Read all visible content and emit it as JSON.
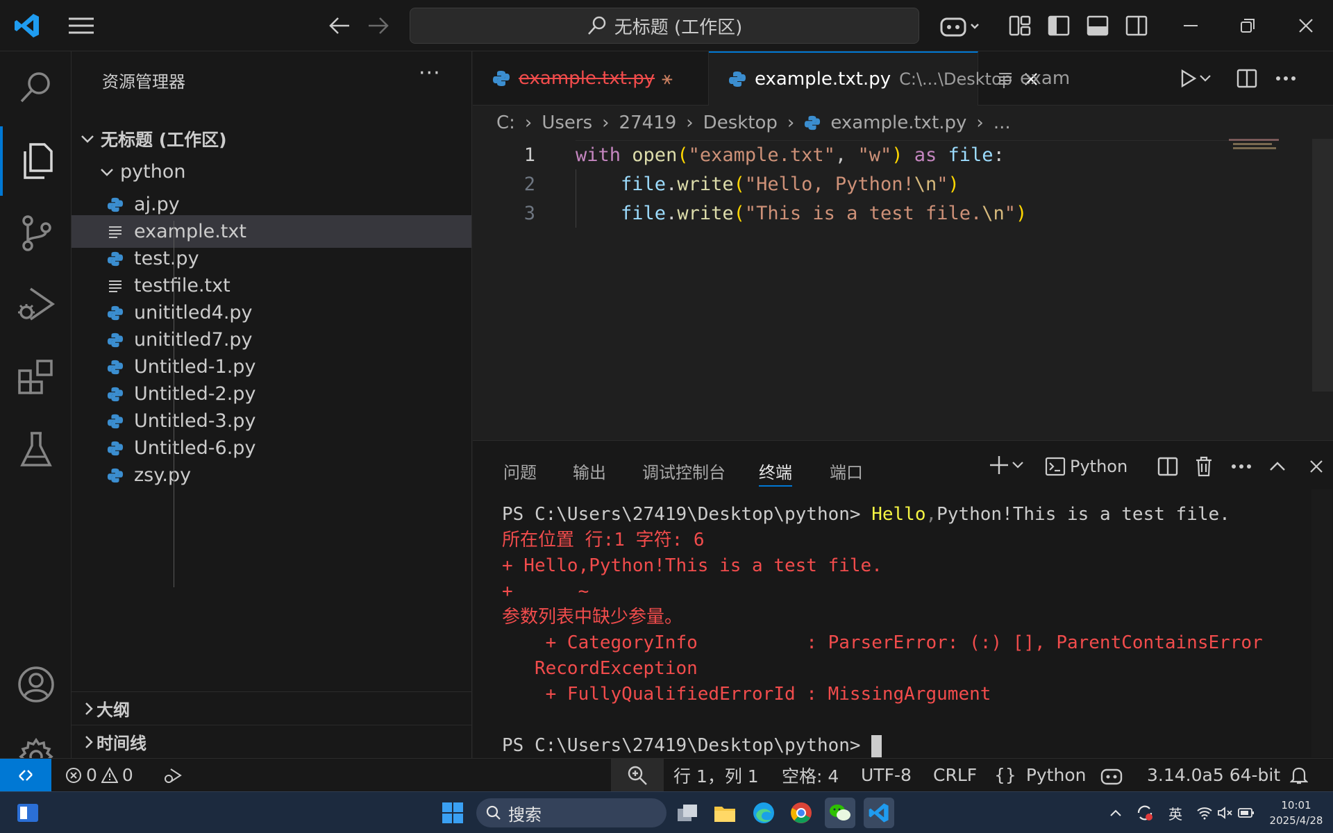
{
  "titlebar": {
    "search_text": "无标题 (工作区)"
  },
  "sidebar": {
    "title": "资源管理器",
    "more": "···",
    "workspace": "无标题 (工作区)",
    "folder": "python",
    "files": [
      {
        "name": "aj.py",
        "type": "python"
      },
      {
        "name": "example.txt",
        "type": "text",
        "selected": true
      },
      {
        "name": "test.py",
        "type": "python"
      },
      {
        "name": "testfile.txt",
        "type": "text"
      },
      {
        "name": "unititled4.py",
        "type": "python"
      },
      {
        "name": "unititled7.py",
        "type": "python"
      },
      {
        "name": "Untitled-1.py",
        "type": "python"
      },
      {
        "name": "Untitled-2.py",
        "type": "python"
      },
      {
        "name": "Untitled-3.py",
        "type": "python"
      },
      {
        "name": "Untitled-6.py",
        "type": "python"
      },
      {
        "name": "zsy.py",
        "type": "python"
      }
    ],
    "sections": [
      "大纲",
      "时间线"
    ]
  },
  "tabs": [
    {
      "label": "example.txt.py",
      "suffix": "",
      "deleted": true
    },
    {
      "label": "example.txt.py",
      "suffix": "C:\\...\\Desktop",
      "active": true
    },
    {
      "label": "example.tx",
      "suffix": ""
    }
  ],
  "breadcrumb": [
    "C:",
    "Users",
    "27419",
    "Desktop",
    "example.txt.py",
    "..."
  ],
  "code": {
    "lines": [
      "1",
      "2",
      "3"
    ]
  },
  "panel": {
    "tabs": [
      "问题",
      "输出",
      "调试控制台",
      "终端",
      "端口"
    ],
    "active_tab": "终端",
    "shell": "Python",
    "terminal": {
      "prompt1": "PS C:\\Users\\27419\\Desktop\\python> ",
      "cmd1a": "Hello",
      "cmd1b": ",",
      "cmd1c": "Python!This is a test file.",
      "err1": "所在位置 行:1 字符: 6",
      "err2": "+ Hello,Python!This is a test file.",
      "err3": "+      ~",
      "err4": "参数列表中缺少参量。",
      "err5": "    + CategoryInfo          : ParserError: (:) [], ParentContainsError",
      "err6": "   RecordException",
      "err7": "    + FullyQualifiedErrorId : MissingArgument",
      "prompt2": "PS C:\\Users\\27419\\Desktop\\python> "
    }
  },
  "statusbar": {
    "errors": "0",
    "warnings": "0",
    "position": "行 1，列 1",
    "spaces": "空格: 4",
    "encoding": "UTF-8",
    "eol": "CRLF",
    "braces": "{}",
    "language": "Python",
    "interpreter": "3.14.0a5 64-bit"
  },
  "taskbar": {
    "search": "搜索",
    "ime": "英",
    "time": "10:01",
    "date": "2025/4/28"
  },
  "colors": {
    "accent": "#0078d4",
    "keyword": "#c586c0",
    "function": "#dcdcaa",
    "string": "#ce9178",
    "variable": "#9cdcfe",
    "paren": "#ffd700",
    "error": "#f14c4c"
  }
}
